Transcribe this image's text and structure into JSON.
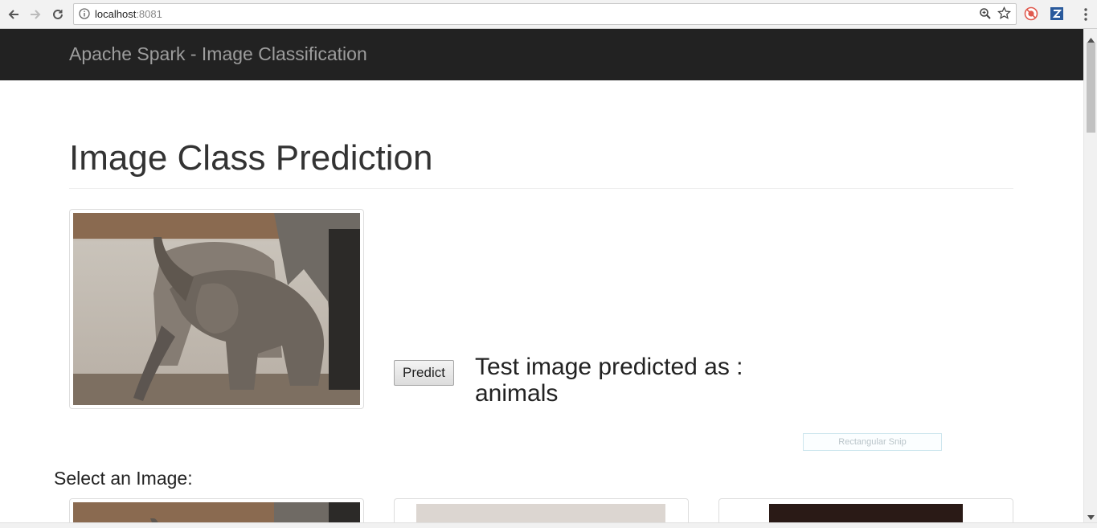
{
  "browser": {
    "url_host": "localhost",
    "url_port": ":8081",
    "icons": [
      "back-icon",
      "forward-icon",
      "reload-icon",
      "info-icon",
      "zoom-icon",
      "star-icon",
      "extension-icon",
      "zotero-icon",
      "menu-icon"
    ]
  },
  "navbar": {
    "brand": "Apache Spark - Image Classification"
  },
  "main": {
    "title": "Image Class Prediction",
    "predict_label": "Predict",
    "prediction_text": "Test image predicted as :",
    "prediction_value": "animals",
    "select_label": "Select an Image:",
    "snip_label": "Rectangular Snip"
  },
  "colors": {
    "navbar_bg": "#222222",
    "brand_text": "#9d9d9d",
    "zotero_blue": "#2a5a9c"
  }
}
